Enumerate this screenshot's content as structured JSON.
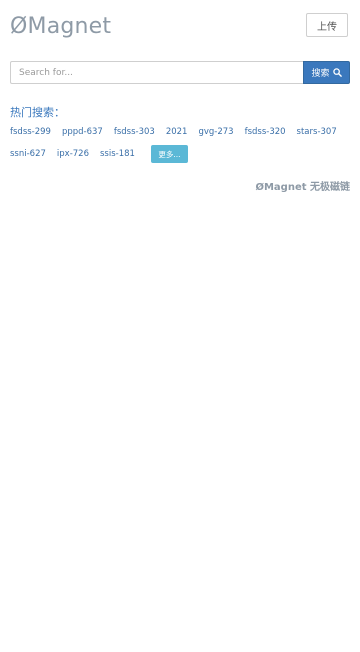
{
  "header": {
    "logo": "ØMagnet",
    "upload_label": "上传"
  },
  "search": {
    "placeholder": "Search for...",
    "button_label": "搜索"
  },
  "hot": {
    "title": "热门搜索：",
    "row1": [
      "fsdss-299",
      "pppd-637",
      "fsdss-303",
      "2021",
      "gvg-273",
      "fsdss-320",
      "stars-307"
    ],
    "row2": [
      "ssni-627",
      "ipx-726",
      "ssis-181"
    ],
    "more_label": "更多..."
  },
  "footer": {
    "text": "ØMagnet 无极磁链"
  },
  "icons": {
    "search_button_icon": "search-icon"
  }
}
